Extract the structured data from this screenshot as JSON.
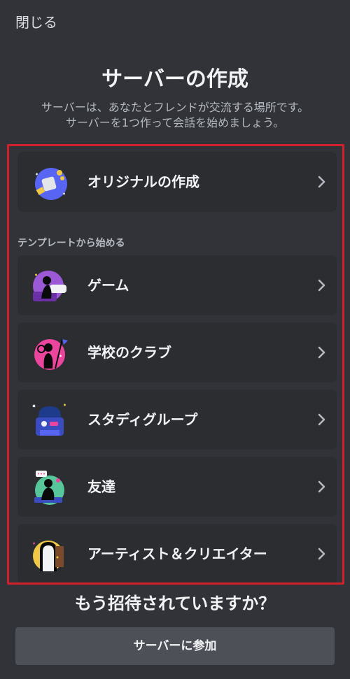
{
  "header": {
    "close_label": "閉じる",
    "title": "サーバーの作成",
    "subtitle_line1": "サーバーは、あなたとフレンドが交流する場所です。",
    "subtitle_line2": "サーバーを1つ作って会話を始めましょう。"
  },
  "create_original": {
    "label": "オリジナルの作成",
    "icon": "create-server-illustration-icon"
  },
  "templates": {
    "section_label": "テンプレートから始める",
    "items": [
      {
        "label": "ゲーム",
        "icon": "gaming-illustration-icon"
      },
      {
        "label": "学校のクラブ",
        "icon": "school-club-illustration-icon"
      },
      {
        "label": "スタディグループ",
        "icon": "study-group-illustration-icon"
      },
      {
        "label": "友達",
        "icon": "friends-illustration-icon"
      },
      {
        "label": "アーティスト＆クリエイター",
        "icon": "artists-illustration-icon"
      }
    ]
  },
  "footer": {
    "join_heading": "もう招待されていますか？",
    "join_button_label": "サーバーに参加"
  },
  "colors": {
    "background": "#313338",
    "card": "#2b2d31",
    "highlight_border": "#d0202b",
    "join_button": "#4e5058"
  }
}
